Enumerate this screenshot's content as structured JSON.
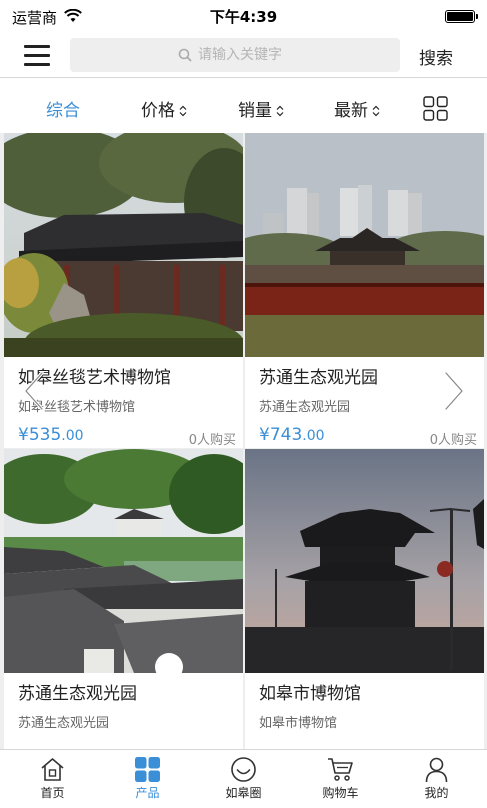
{
  "status_bar": {
    "carrier": "运营商",
    "time": "下午4:39"
  },
  "header": {
    "search_placeholder": "请输入关键字",
    "search_button": "搜索"
  },
  "filters": [
    {
      "label": "综合",
      "active": true
    },
    {
      "label": "价格",
      "active": false
    },
    {
      "label": "销量",
      "active": false
    },
    {
      "label": "最新",
      "active": false
    }
  ],
  "products": [
    {
      "title": "如皋丝毯艺术博物馆",
      "subtitle": "如皋丝毯艺术博物馆",
      "price_main": "¥535",
      "price_decimal": ".00",
      "sold": "0人购买"
    },
    {
      "title": "苏通生态观光园",
      "subtitle": "苏通生态观光园",
      "price_main": "¥743",
      "price_decimal": ".00",
      "sold": "0人购买"
    },
    {
      "title": "苏通生态观光园",
      "subtitle": "苏通生态观光园"
    },
    {
      "title": "如皋市博物馆",
      "subtitle": "如皋市博物馆"
    }
  ],
  "tabbar": [
    {
      "label": "首页",
      "icon": "home-icon"
    },
    {
      "label": "产品",
      "icon": "grid-icon",
      "active": true
    },
    {
      "label": "如皋圈",
      "icon": "smile-circle-icon"
    },
    {
      "label": "购物车",
      "icon": "cart-icon"
    },
    {
      "label": "我的",
      "icon": "user-icon"
    }
  ],
  "colors": {
    "accent": "#3a8fd6",
    "text": "#222222",
    "muted": "#888888",
    "divider": "#d8d8d8",
    "background": "#eeeeee"
  }
}
